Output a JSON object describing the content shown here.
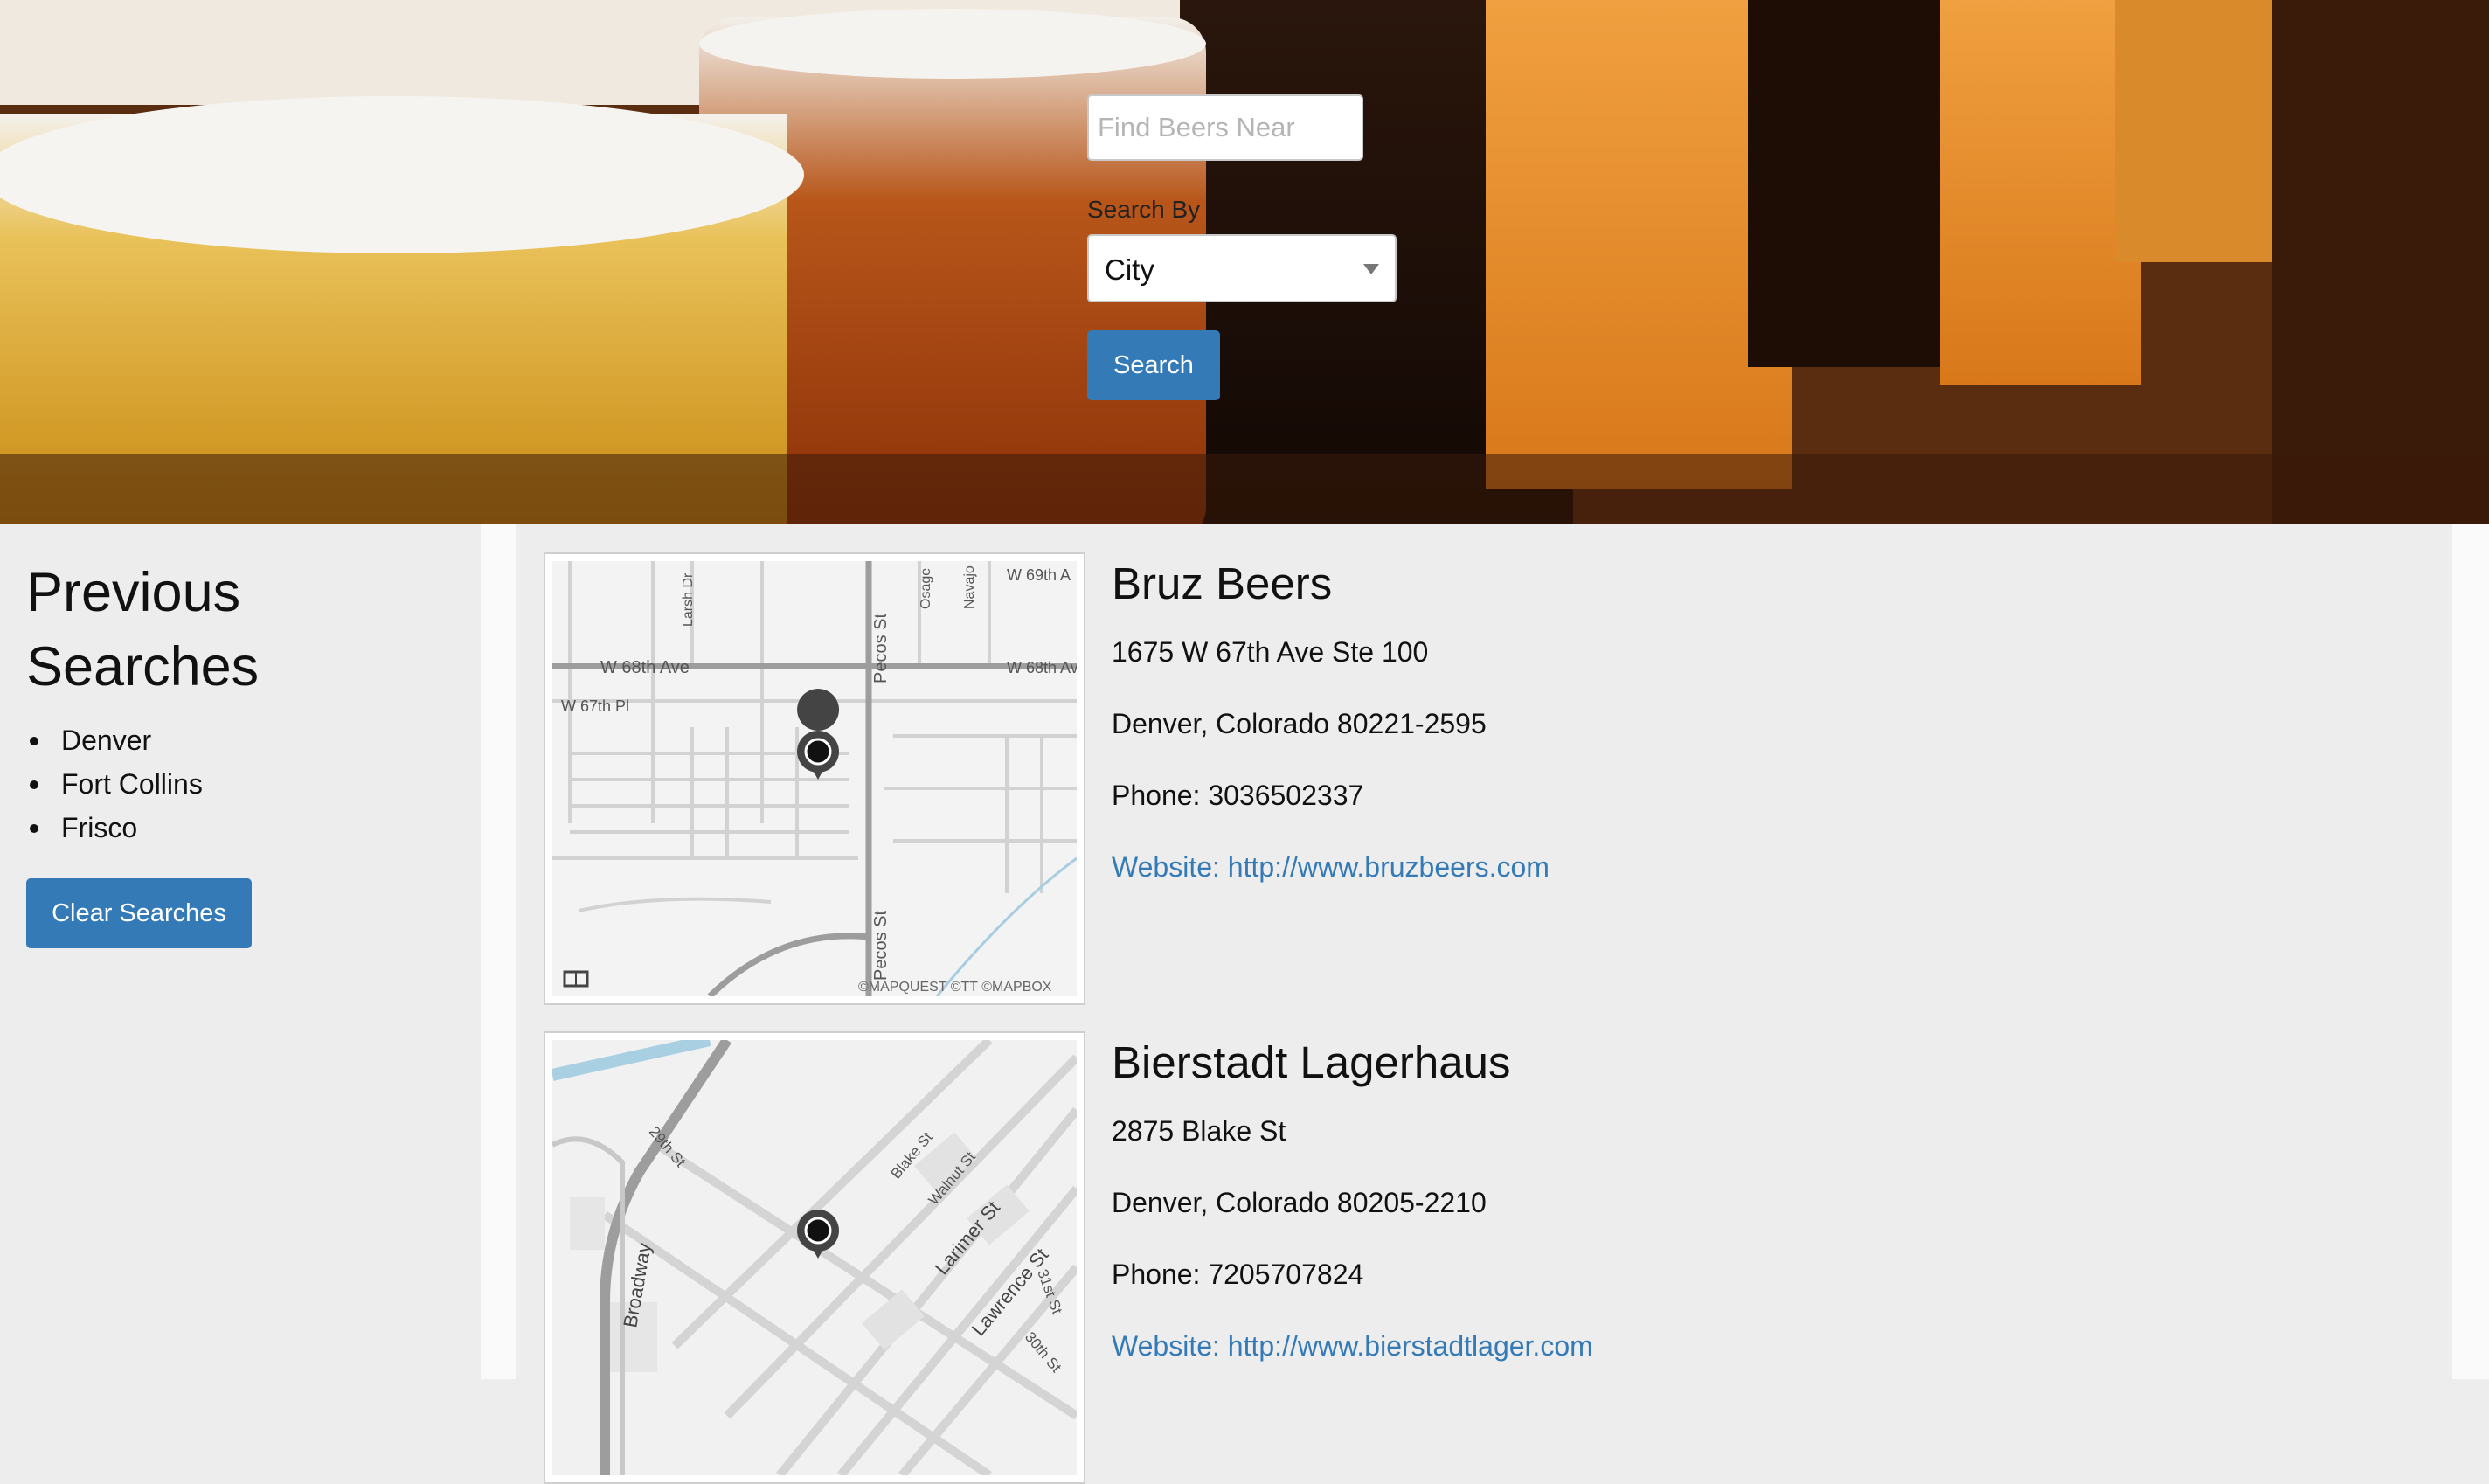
{
  "search": {
    "placeholder": "Find Beers Near",
    "search_by_label": "Search By",
    "search_by_value": "City",
    "search_button": "Search"
  },
  "sidebar": {
    "title": "Previous Searches",
    "items": [
      "Denver",
      "Fort Collins",
      "Frisco"
    ],
    "clear_button": "Clear Searches"
  },
  "results": [
    {
      "name": "Bruz Beers",
      "address": "1675 W 67th Ave Ste 100",
      "city_line": "Denver, Colorado 80221-2595",
      "phone": "Phone: 3036502337",
      "website": "Website: http://www.bruzbeers.com",
      "map": {
        "street_labels": [
          "W 68th Ave",
          "Pecos St",
          "W 68th Av",
          "W 67th Pl",
          "Larsh Dr",
          "Osage",
          "Navajo",
          "W 69th A",
          "Pecos St"
        ],
        "attribution": "©MAPQUEST ©TT ©MAPBOX"
      }
    },
    {
      "name": "Bierstadt Lagerhaus",
      "address": "2875 Blake St",
      "city_line": "Denver, Colorado 80205-2210",
      "phone": "Phone: 7205707824",
      "website": "Website: http://www.bierstadtlager.com",
      "map": {
        "street_labels": [
          "29th St",
          "Blake St",
          "Walnut St",
          "Larimer St",
          "Lawrence St",
          "Broadway",
          "31st St",
          "30th St"
        ]
      }
    }
  ],
  "colors": {
    "primary_button": "#337ab7",
    "link": "#337ab7",
    "panel_bg": "#ededed"
  },
  "icons": {
    "map_marker": "map-pin-icon",
    "map_legend": "map-book-icon",
    "select_arrow": "chevron-down-icon"
  }
}
